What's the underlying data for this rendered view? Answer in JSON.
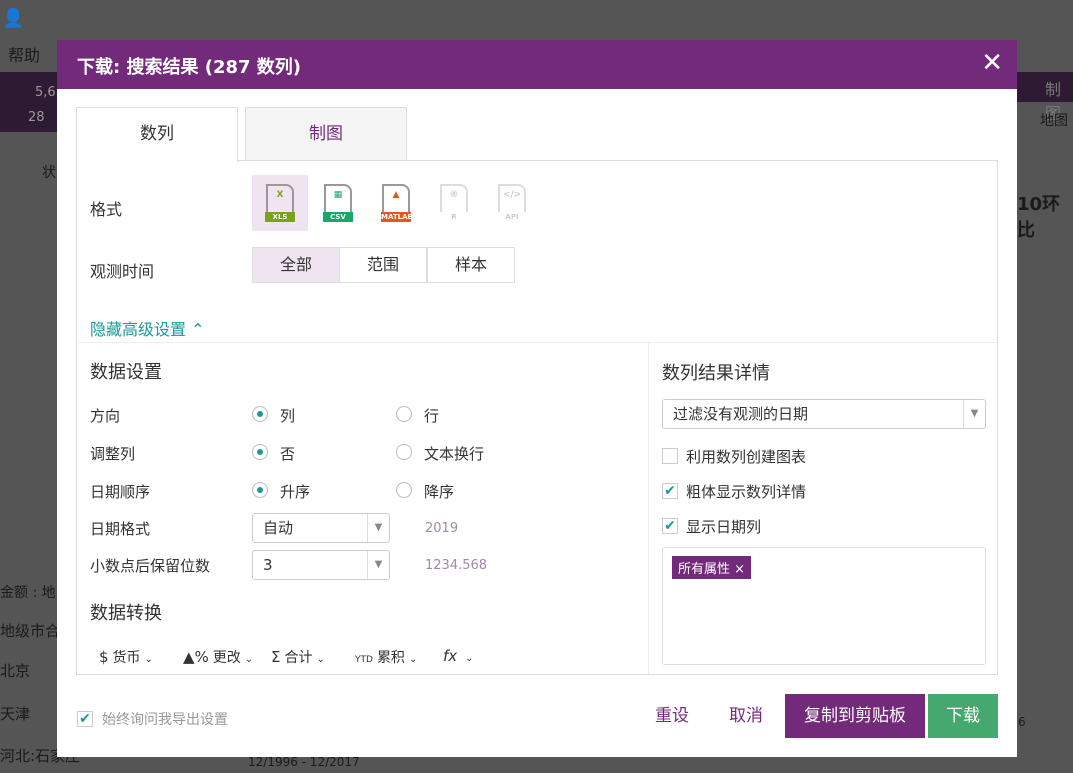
{
  "background": {
    "help": "帮助",
    "stat1": "5,6",
    "stat2": "28",
    "chart_tab": "制图",
    "map": "地图",
    "heading": "10环比",
    "col": "状",
    "amount": "金额 : 地",
    "rows": [
      "地级市合",
      "北京",
      "天津",
      "河北:石家庄"
    ],
    "range": "12/1996 - 12/2017",
    "axis": "6"
  },
  "dialog": {
    "title": "下载: 搜索结果 (287 数列)",
    "close": "✕",
    "tabs": [
      "数列",
      "制图"
    ],
    "format_label": "格式",
    "formats": [
      {
        "name": "XLS",
        "glyph": "X",
        "color": "#7aa21a"
      },
      {
        "name": "CSV",
        "glyph": "▦",
        "color": "#1aa86a"
      },
      {
        "name": "MATLAB",
        "glyph": "▲",
        "color": "#e05a1a"
      },
      {
        "name": "R",
        "glyph": "®",
        "color": "#ccc"
      },
      {
        "name": "API",
        "glyph": "</>",
        "color": "#ccc"
      }
    ],
    "time_label": "观测时间",
    "time_options": [
      "全部",
      "范围",
      "样本"
    ],
    "advanced_link": "隐藏高级设置 ⌃",
    "data_settings": "数据设置",
    "direction": {
      "label": "方向",
      "opt1": "列",
      "opt2": "行"
    },
    "adjust": {
      "label": "调整列",
      "opt1": "否",
      "opt2": "文本换行"
    },
    "date_order": {
      "label": "日期顺序",
      "opt1": "升序",
      "opt2": "降序"
    },
    "date_format": {
      "label": "日期格式",
      "value": "自动",
      "hint": "2019"
    },
    "decimals": {
      "label": "小数点后保留位数",
      "value": "3",
      "hint": "1234.568"
    },
    "transform": "数据转换",
    "tools": [
      {
        "icon": "$",
        "label": "货币"
      },
      {
        "icon": "▲%",
        "label": "更改"
      },
      {
        "icon": "Σ",
        "label": "合计"
      },
      {
        "icon": "YTD",
        "label": "累积"
      },
      {
        "icon": "fx",
        "label": ""
      }
    ],
    "details_title": "数列结果详情",
    "filter_value": "过滤没有观测的日期",
    "checks": [
      {
        "label": "利用数列创建图表",
        "checked": false
      },
      {
        "label": "粗体显示数列详情",
        "checked": true
      },
      {
        "label": "显示日期列",
        "checked": true
      }
    ],
    "tag": "所有属性 ×",
    "always_ask": "始终询问我导出设置",
    "reset": "重设",
    "cancel": "取消",
    "copy": "复制到剪贴板",
    "download": "下载",
    "colors": {
      "purple": "#742a7b",
      "green": "#45a86e",
      "teal": "#1a9a9a"
    }
  }
}
